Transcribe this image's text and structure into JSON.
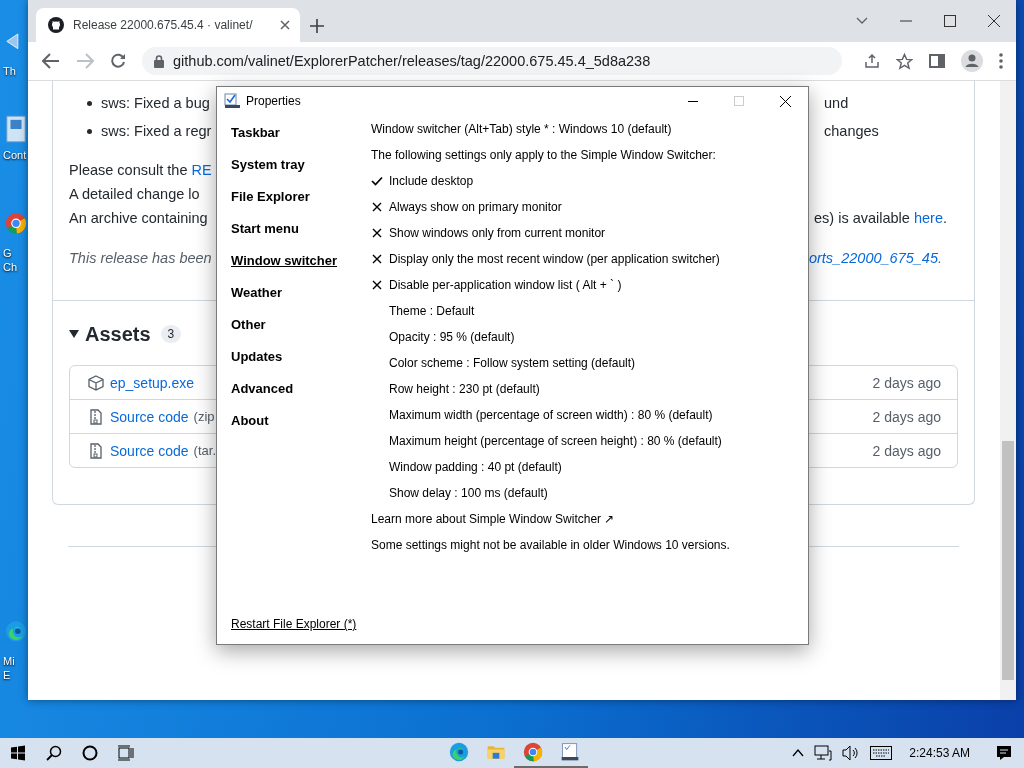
{
  "desktop_icons": [
    {
      "kind": "recycle",
      "lines": [
        "Th"
      ]
    },
    {
      "kind": "panel",
      "lines": [
        "Cont"
      ]
    },
    {
      "kind": "chrome",
      "lines": [
        "G",
        "Ch"
      ]
    },
    {
      "kind": "edge",
      "lines": [
        "Mi",
        "E"
      ]
    }
  ],
  "browser": {
    "tab": {
      "title": "Release 22000.675.45.4 · valinet/",
      "selected": true
    },
    "url": "github.com/valinet/ExplorerPatcher/releases/tag/22000.675.45.4_5d8a238",
    "bullets": [
      {
        "left": "sws: Fixed a bug",
        "right": "und"
      },
      {
        "left": "sws: Fixed a regr",
        "right": "changes"
      }
    ],
    "paragraphs": [
      {
        "left": "Please consult the ",
        "left_link": "RE"
      },
      {
        "left": "A detailed change lo"
      },
      {
        "left": "An archive containing",
        "right": "es) is available ",
        "right_link": "here",
        "right_end": "."
      }
    ],
    "note": {
      "left": "This release has been",
      "right_link": "orts_22000_675_45",
      "right_end": "."
    },
    "assets": {
      "title": "Assets",
      "count": "3",
      "rows": [
        {
          "kind": "package",
          "name": "ep_setup.exe",
          "time": "2 days ago"
        },
        {
          "kind": "zip",
          "name": "Source code",
          "suffix": "(zip",
          "time": "2 days ago"
        },
        {
          "kind": "zip",
          "name": "Source code",
          "suffix": "(tar.",
          "time": "2 days ago"
        }
      ]
    }
  },
  "dialog": {
    "title": "Properties",
    "sidebar": [
      {
        "label": "Taskbar",
        "selected": false
      },
      {
        "label": "System tray",
        "selected": false
      },
      {
        "label": "File Explorer",
        "selected": false
      },
      {
        "label": "Start menu",
        "selected": false
      },
      {
        "label": "Window switcher",
        "selected": true
      },
      {
        "label": "Weather",
        "selected": false
      },
      {
        "label": "Other",
        "selected": false
      },
      {
        "label": "Updates",
        "selected": false
      },
      {
        "label": "Advanced",
        "selected": false
      },
      {
        "label": "About",
        "selected": false
      }
    ],
    "rows": [
      {
        "kind": "text",
        "text": "Window switcher (Alt+Tab) style * : Windows 10 (default)"
      },
      {
        "kind": "text",
        "text": "The following settings only apply to the Simple Window Switcher:"
      },
      {
        "kind": "check",
        "text": "Include desktop",
        "checked": true
      },
      {
        "kind": "check",
        "text": "Always show on primary monitor",
        "checked": false
      },
      {
        "kind": "check",
        "text": "Show windows only from current monitor",
        "checked": false
      },
      {
        "kind": "check",
        "text": "Display only the most recent window (per application switcher)",
        "checked": false
      },
      {
        "kind": "check",
        "text": "Disable per-application window list ( Alt + ` )",
        "checked": false
      },
      {
        "kind": "option",
        "text": "Theme : Default"
      },
      {
        "kind": "option",
        "text": "Opacity : 95 % (default)"
      },
      {
        "kind": "option",
        "text": "Color scheme : Follow system setting (default)"
      },
      {
        "kind": "option",
        "text": "Row height : 230 pt (default)"
      },
      {
        "kind": "option",
        "text": "Maximum width (percentage of screen width) : 80 % (default)"
      },
      {
        "kind": "option",
        "text": "Maximum height (percentage of screen height) : 80 % (default)"
      },
      {
        "kind": "option",
        "text": "Window padding : 40 pt (default)"
      },
      {
        "kind": "option",
        "text": "Show delay : 100 ms (default)"
      },
      {
        "kind": "link",
        "text": "Learn more about Simple Window Switcher ↗"
      },
      {
        "kind": "text",
        "text": "Some settings might not be available in older Windows 10 versions."
      }
    ],
    "footer_link": "Restart File Explorer (*)"
  },
  "taskbar": {
    "apps": [
      {
        "kind": "edge",
        "active": false
      },
      {
        "kind": "folder",
        "active": false
      },
      {
        "kind": "chrome",
        "active": true
      },
      {
        "kind": "app",
        "active": true
      }
    ],
    "clock": "2:24:53 AM"
  }
}
